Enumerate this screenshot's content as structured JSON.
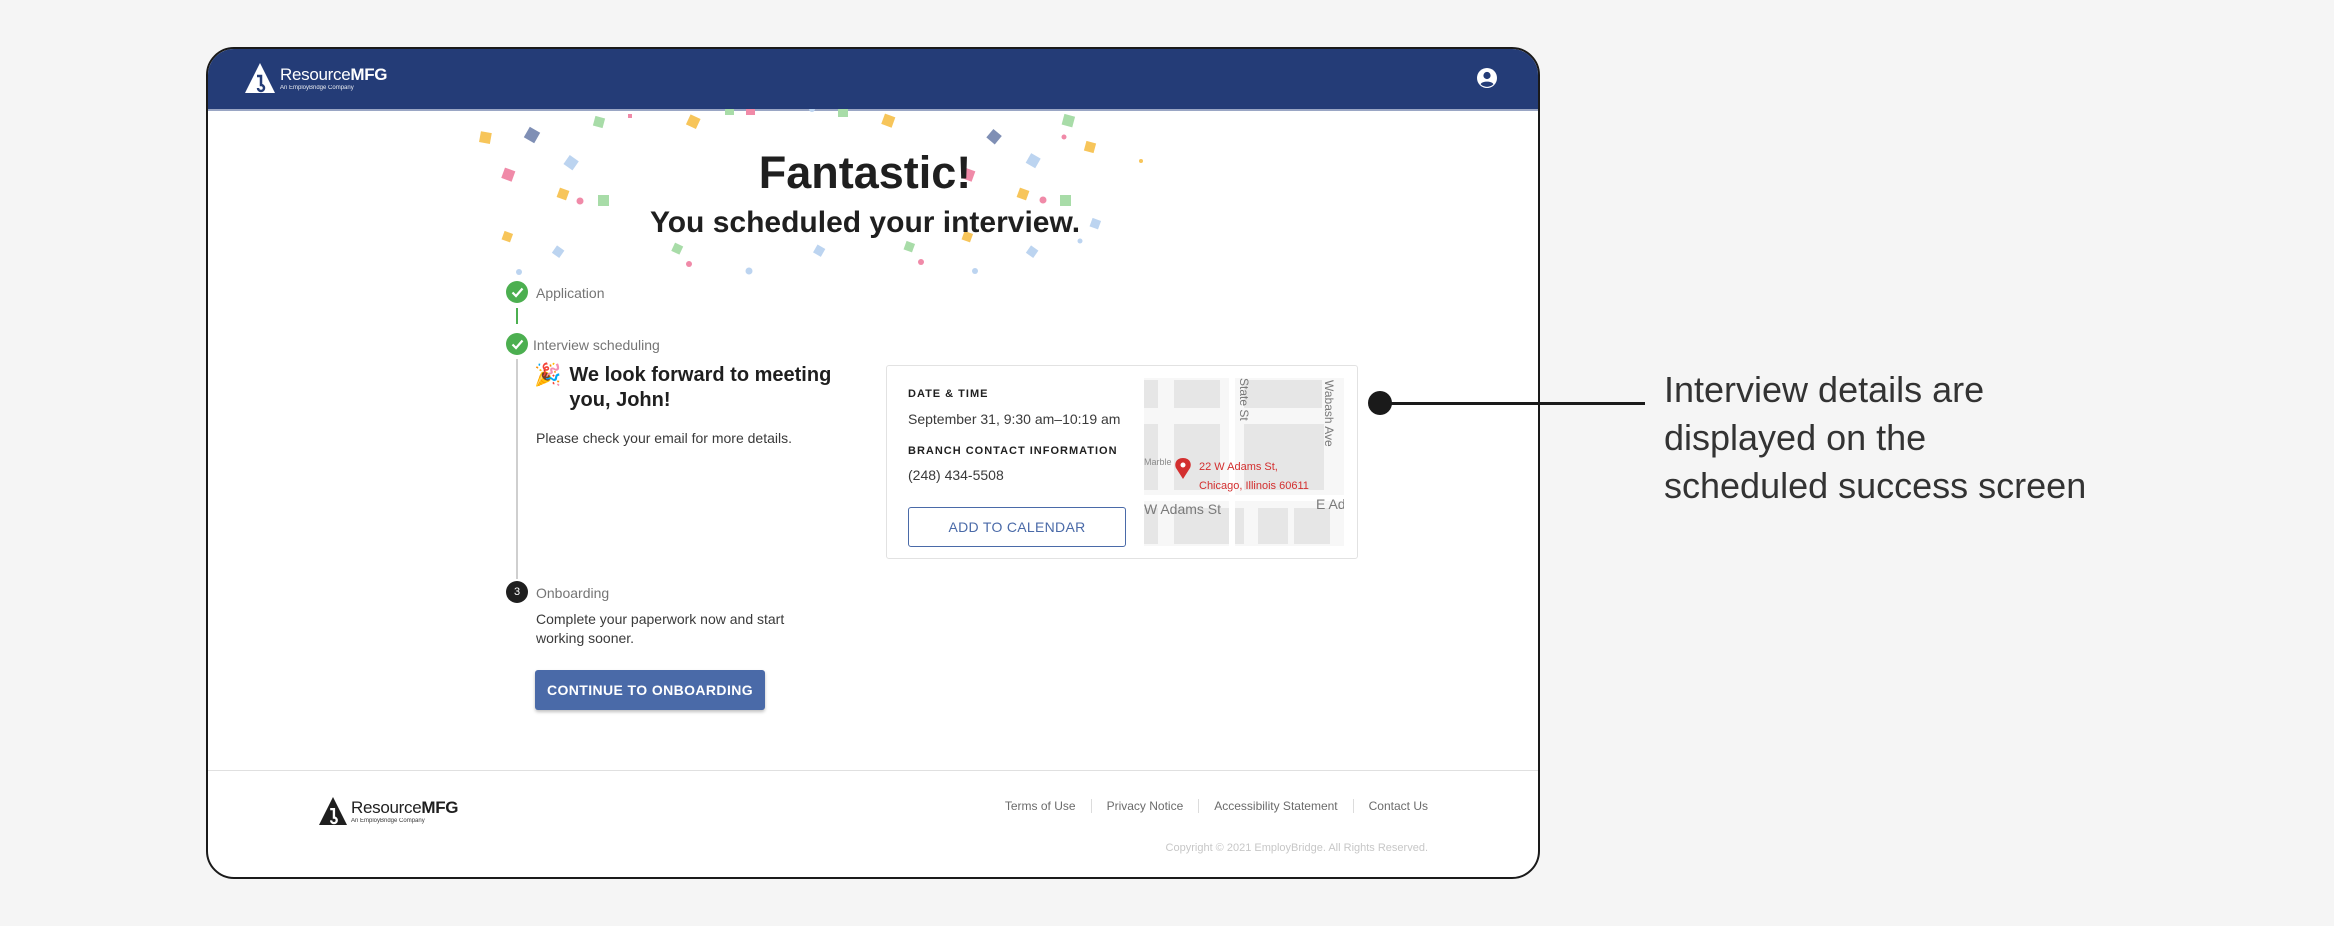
{
  "header": {
    "brand_name": "Resource",
    "brand_bold": "MFG",
    "brand_tagline": "An EmployBridge Company"
  },
  "hero": {
    "title": "Fantastic!",
    "subtitle": "You scheduled your interview."
  },
  "steps": [
    {
      "label": "Application",
      "status": "done"
    },
    {
      "label": "Interview scheduling",
      "status": "done"
    },
    {
      "label": "Onboarding",
      "status": "pending",
      "number": "3"
    }
  ],
  "interview": {
    "emoji": "🎉",
    "greeting": "We look forward to meeting you, John!",
    "note": "Please check your email for more details."
  },
  "onboarding": {
    "description": "Complete your paperwork now and start working sooner.",
    "button_label": "CONTINUE TO ONBOARDING"
  },
  "details_card": {
    "date_heading": "DATE & TIME",
    "date_value": "September 31, 9:30 am–10:19 am",
    "contact_heading": "BRANCH CONTACT INFORMATION",
    "phone": "(248) 434-5508",
    "calendar_button": "ADD TO CALENDAR"
  },
  "map": {
    "street_state": "State St",
    "street_wabash": "Wabash Ave",
    "street_marble": "Marble",
    "street_adams": "W Adams St",
    "street_e_adams": "E Ad",
    "address_line1": "22 W Adams St,",
    "address_line2": "Chicago, Illinois 60611",
    "pin_color": "#d32f2f"
  },
  "footer": {
    "brand_name": "Resource",
    "brand_bold": "MFG",
    "brand_tagline": "An EmployBridge Company",
    "links": [
      "Terms of Use",
      "Privacy Notice",
      "Accessibility Statement",
      "Contact Us"
    ],
    "copyright": "Copyright © 2021 EmployBridge. All Rights Reserved."
  },
  "annotation": {
    "text": "Interview details are\ndisplayed on the\nscheduled success screen"
  },
  "colors": {
    "header_bg": "#243c77",
    "primary_button": "#4a6aa8",
    "success_green": "#4caf50"
  }
}
